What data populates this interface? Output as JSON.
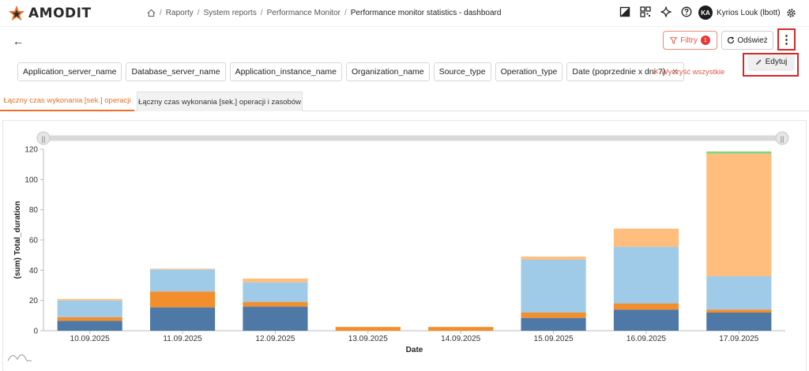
{
  "app": {
    "logo_text": "AMODIT",
    "logo_colors": {
      "orange": "#e8702a",
      "dark": "#2b2b2b"
    }
  },
  "breadcrumb": {
    "items": [
      "Raporty",
      "System reports",
      "Performance Monitor",
      "Performance monitor statistics - dashboard"
    ]
  },
  "header_icons": [
    "image-icon",
    "qr-code-icon",
    "sparkle-icon",
    "help-icon"
  ],
  "user": {
    "initials": "KA",
    "name": "Kyrios Louk (lbott)"
  },
  "toolbar": {
    "filters_label": "Filtry",
    "filters_count": "1",
    "refresh_label": "Odśwież",
    "edit_label": "Edytuj"
  },
  "filters": {
    "chips": [
      "Application_server_name",
      "Database_server_name",
      "Application_instance_name",
      "Organization_name",
      "Source_type",
      "Operation_type",
      "Date (poprzednie x dni 7)"
    ],
    "clear_all_label": "Wyczyść wszystkie"
  },
  "tabs": [
    {
      "label": "Łączny czas wykonania [sek.] operacji",
      "active": true
    },
    {
      "label": "Łączny czas wykonania [sek.] operacji i zasobów",
      "active": false
    }
  ],
  "accent_colors": {
    "primary": "#e8702a",
    "danger": "#e53935",
    "highlight_box": "#d62828"
  },
  "chart_data": {
    "type": "bar",
    "stacked": true,
    "categories": [
      "10.09.2025",
      "11.09.2025",
      "12.09.2025",
      "13.09.2025",
      "14.09.2025",
      "15.09.2025",
      "16.09.2025",
      "17.09.2025"
    ],
    "series": [
      {
        "color": "#4e79a7",
        "values": [
          6.5,
          15.5,
          16,
          0,
          0,
          8.5,
          14,
          12
        ]
      },
      {
        "color": "#f28e2b",
        "values": [
          2.5,
          10.5,
          3,
          2.5,
          2.5,
          3.5,
          4,
          2
        ]
      },
      {
        "color": "#a0cbe8",
        "values": [
          11,
          14.5,
          13,
          0,
          0,
          35,
          37.5,
          22
        ]
      },
      {
        "color": "#ffbe7d",
        "values": [
          1,
          0.5,
          2.5,
          0,
          0,
          2,
          12,
          81
        ]
      },
      {
        "color": "#8cd17d",
        "values": [
          0,
          0,
          0,
          0,
          0,
          0,
          0,
          1.5
        ]
      }
    ],
    "title": "",
    "xlabel": "Date",
    "ylabel": "(sum) Total_duration",
    "ylim": [
      0,
      120
    ],
    "yticks": [
      0,
      20,
      40,
      60,
      80,
      100,
      120
    ],
    "grid": false,
    "legend": "none",
    "range_slider": true
  }
}
